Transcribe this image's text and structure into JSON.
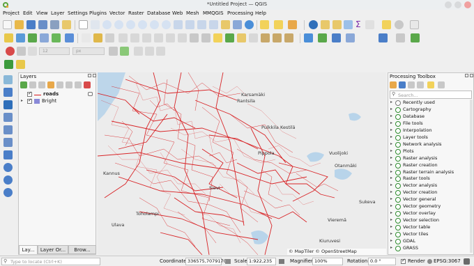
{
  "window": {
    "title": "*Untitled Project — QGIS"
  },
  "menu": [
    "Project",
    "Edit",
    "View",
    "Layer",
    "Settings",
    "Plugins",
    "Vector",
    "Raster",
    "Database",
    "Web",
    "Mesh",
    "MMQGIS",
    "Processing",
    "Help"
  ],
  "digitizing": {
    "size_value": "12",
    "unit": "px"
  },
  "layers_panel": {
    "title": "Layers",
    "layers": [
      {
        "name": "roads",
        "checked": true,
        "line_color": "#d7191c"
      },
      {
        "name": "Bright",
        "checked": true
      }
    ],
    "tabs": [
      "Lay...",
      "Layer Or...",
      "Brow..."
    ]
  },
  "map": {
    "attribution": "© MapTiler  © OpenStreetMap contributors",
    "road_color": "#d7191c",
    "place_names": [
      "Karsamäki",
      "Rantsila",
      "Kestilä",
      "Pulkkila",
      "Pippola",
      "Vuolijoki",
      "Otanmäki",
      "Kannus",
      "Toholampi",
      "Ulava",
      "Sievi",
      "Sukeva",
      "Vieremä",
      "Kiuruvesi"
    ]
  },
  "processing_toolbox": {
    "title": "Processing Toolbox",
    "search_placeholder": "Search...",
    "items": [
      "Recently used",
      "Cartography",
      "Database",
      "File tools",
      "Interpolation",
      "Layer tools",
      "Network analysis",
      "Plots",
      "Raster analysis",
      "Raster creation",
      "Raster terrain analysis",
      "Raster tools",
      "Vector analysis",
      "Vector creation",
      "Vector general",
      "Vector geometry",
      "Vector overlay",
      "Vector selection",
      "Vector table",
      "Vector tiles",
      "GDAL",
      "GRASS"
    ]
  },
  "statusbar": {
    "locate_placeholder": "Type to locate (Ctrl+K)",
    "coordinate_label": "Coordinate",
    "coordinate_value": "336575,7079170",
    "scale_label": "Scale",
    "scale_value": "1:922,235",
    "magnifier_label": "Magnifier",
    "magnifier_value": "100%",
    "rotation_label": "Rotation",
    "rotation_value": "0.0 °",
    "render_label": "Render",
    "crs_label": "EPSG:3067"
  }
}
